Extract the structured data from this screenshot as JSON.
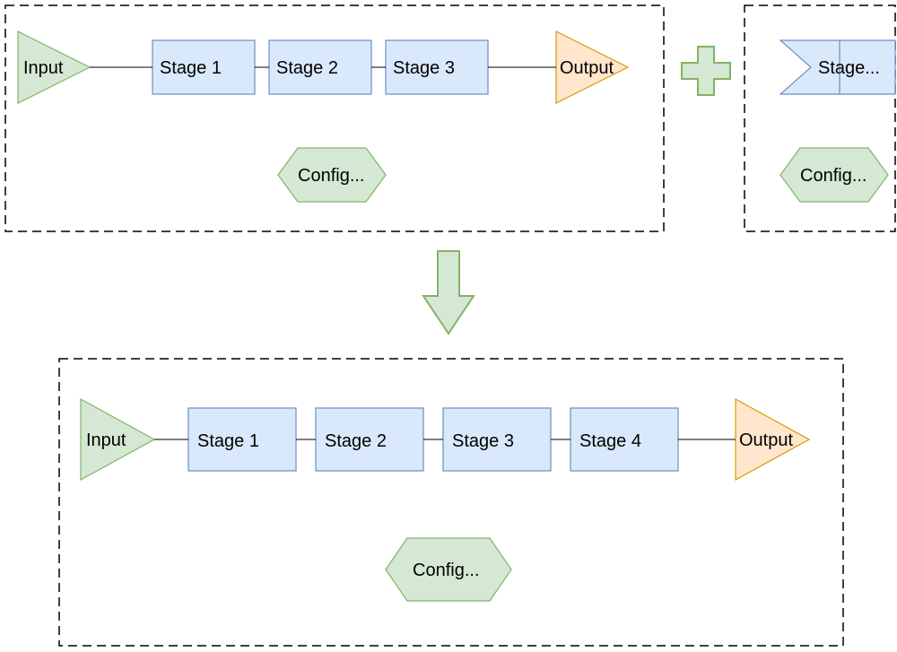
{
  "top_left": {
    "input": "Input",
    "stages": [
      "Stage 1",
      "Stage 2",
      "Stage 3"
    ],
    "output": "Output",
    "config": "Config..."
  },
  "top_right": {
    "stage": "Stage...",
    "config": "Config..."
  },
  "bottom": {
    "input": "Input",
    "stages": [
      "Stage 1",
      "Stage 2",
      "Stage 3",
      "Stage 4"
    ],
    "output": "Output",
    "config": "Config..."
  },
  "colors": {
    "stage_fill": "#dae8fc",
    "stage_stroke": "#6c8ebf",
    "green_fill": "#d5e8d4",
    "green_stroke": "#82b366",
    "orange_fill": "#ffe6cc",
    "orange_stroke": "#d79b00"
  }
}
